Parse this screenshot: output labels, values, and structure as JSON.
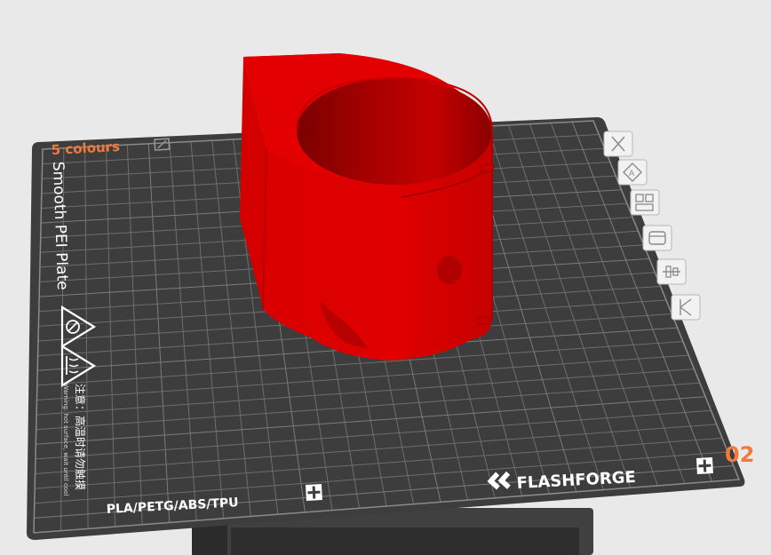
{
  "plate": {
    "colour_label": "5 colours",
    "name": "Smooth PEI Plate",
    "warning_cn": "注意：高温时请勿触摸",
    "warning_en": "Warning: hot surface, wait until cool",
    "materials": "PLA/PETG/ABS/TPU",
    "brand": "FLASHFORGE",
    "plate_number": "02"
  },
  "colors": {
    "background": "#e9e9e9",
    "bed": "#3d3d3d",
    "grid": "#6e6e6e",
    "model": "#e60000",
    "accent": "#f07a3a"
  },
  "toolbar": {
    "icons": [
      "close-icon",
      "auto-orient-icon",
      "arrange-icon",
      "plate-settings-icon",
      "slice-settings-icon",
      "lock-icon"
    ]
  },
  "model": {
    "name": "red-cylindrical-part"
  }
}
